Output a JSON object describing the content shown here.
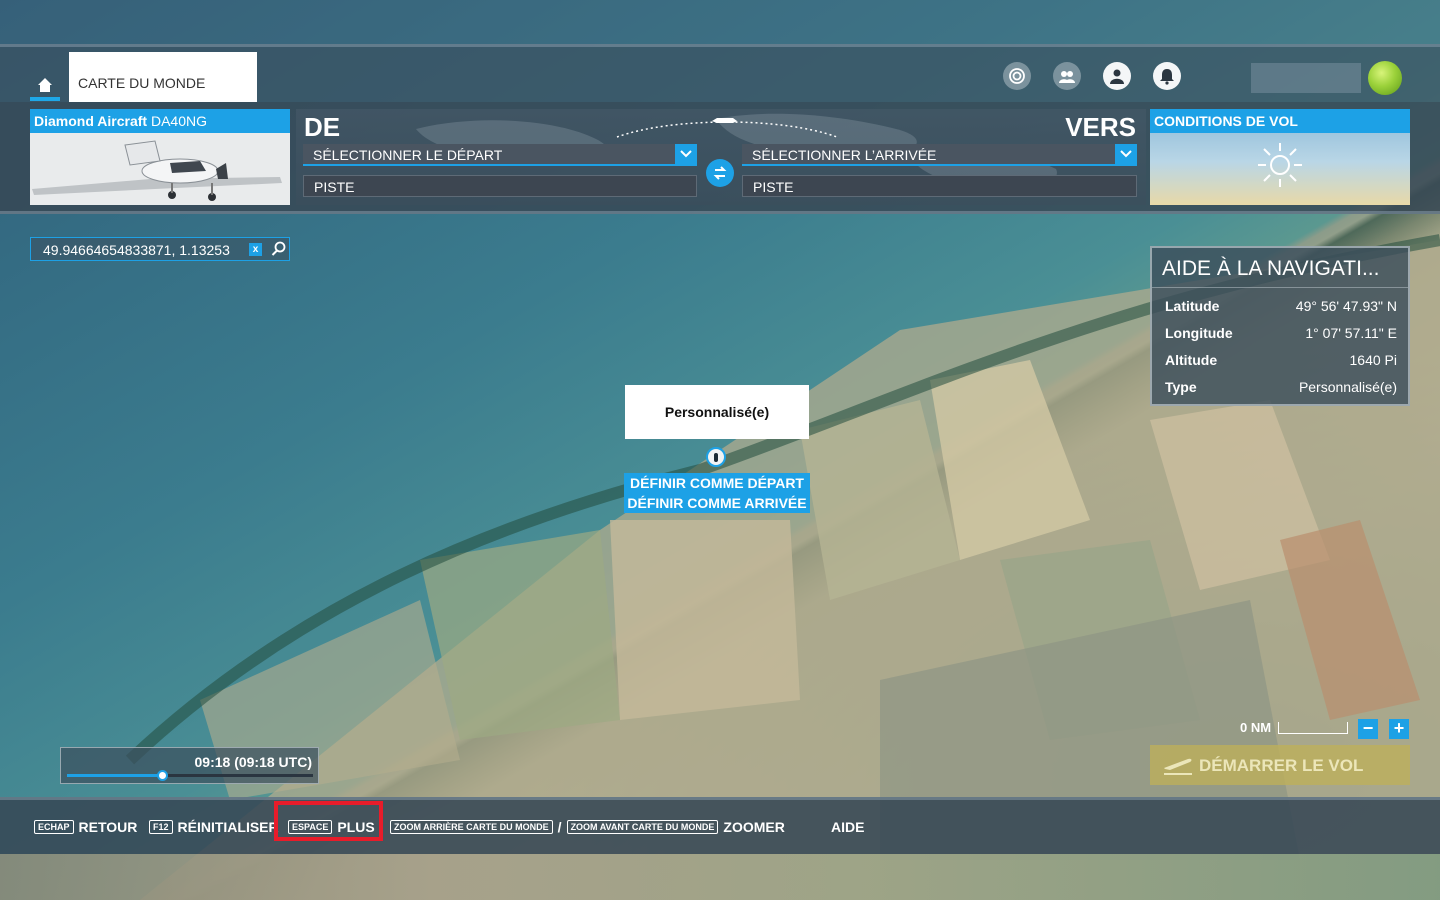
{
  "topbar": {
    "tab_label": "CARTE DU MONDE"
  },
  "aircraft": {
    "brand": "Diamond Aircraft",
    "model": "DA40NG"
  },
  "route": {
    "from_label": "DE",
    "to_label": "VERS",
    "departure_placeholder": "SÉLECTIONNER LE DÉPART",
    "arrival_placeholder": "SÉLECTIONNER L’ARRIVÉE",
    "departure_runway": "PISTE",
    "arrival_runway": "PISTE"
  },
  "conditions": {
    "title": "CONDITIONS DE VOL",
    "weather_icon": "sun-icon"
  },
  "search": {
    "value": "49.94664654833871, 1.13253"
  },
  "navaid": {
    "title": "AIDE À LA NAVIGATI...",
    "rows": [
      {
        "key": "Latitude",
        "value": "49° 56' 47.93\" N"
      },
      {
        "key": "Longitude",
        "value": "1° 07' 57.11\" E"
      },
      {
        "key": "Altitude",
        "value": "1640 Pi"
      },
      {
        "key": "Type",
        "value": "Personnalisé(e)"
      }
    ]
  },
  "marker": {
    "title": "Personnalisé(e)",
    "set_departure": "DÉFINIR COMME DÉPART",
    "set_arrival": "DÉFINIR COMME ARRIVÉE"
  },
  "map_controls": {
    "scale_label": "0 NM",
    "zoom_out": "−",
    "zoom_in": "+",
    "start_flight": "DÉMARRER LE VOL"
  },
  "time": {
    "label": "09:18 (09:18 UTC)",
    "progress": 0.39
  },
  "bottombar": {
    "back_key": "ECHAP",
    "back_label": "RETOUR",
    "reset_key": "F12",
    "reset_label": "RÉINITIALISER",
    "more_key": "ESPACE",
    "more_label": "PLUS",
    "zoom_out_key": "ZOOM ARRIÈRE CARTE DU MONDE",
    "zoom_sep": "/",
    "zoom_in_key": "ZOOM AVANT CARTE DU MONDE",
    "zoom_label": "ZOOMER",
    "help_label": "AIDE"
  },
  "colors": {
    "accent": "#1da1e6",
    "highlight": "#e81c2a"
  }
}
